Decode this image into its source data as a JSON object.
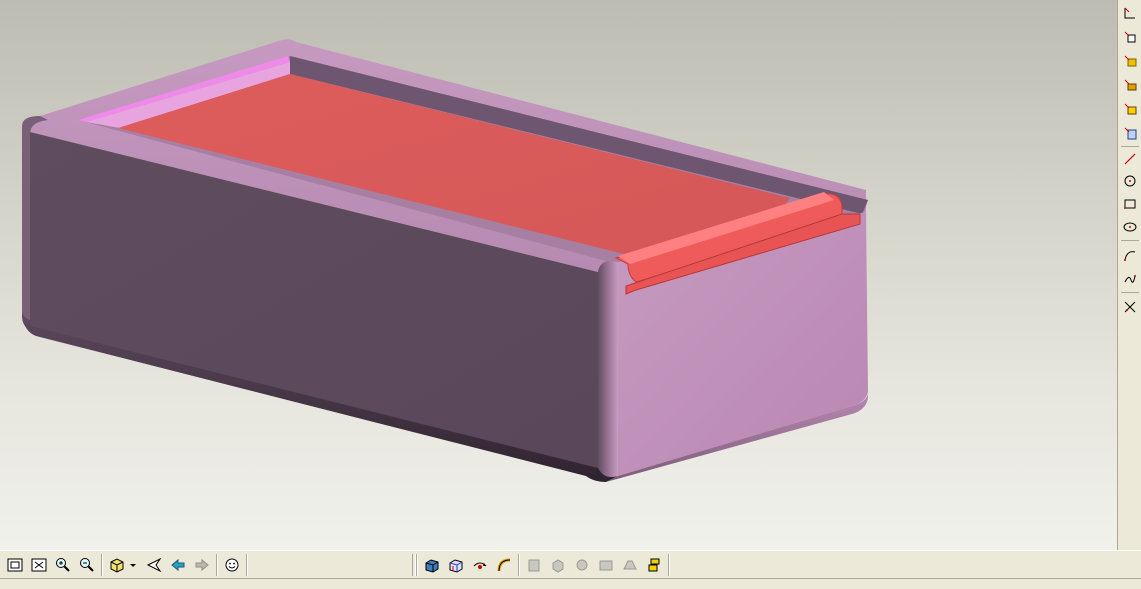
{
  "app": {
    "window_title": ""
  },
  "viewport": {
    "background_top": "#bcbcb2",
    "background_bottom": "#f1f1ec",
    "model": {
      "description_visible": false,
      "body_color_dark": "#5e4b5e",
      "body_color_light": "#bf91b9",
      "inner_floor_color": "#d95c5c",
      "highlight_color": "#f08aea"
    }
  },
  "right_toolbar": {
    "items": [
      {
        "name": "datum-plane-icon"
      },
      {
        "name": "datum-axis-icon"
      },
      {
        "name": "extrude-icon"
      },
      {
        "name": "revolve-icon"
      },
      {
        "name": "sweep-icon"
      },
      {
        "name": "blend-icon"
      },
      {
        "name": "sketch-line-icon"
      },
      {
        "name": "sketch-circle-icon"
      },
      {
        "name": "sketch-rectangle-icon"
      },
      {
        "name": "sketch-ellipse-icon"
      },
      {
        "name": "sketch-arc-icon"
      },
      {
        "name": "sketch-spline-icon"
      },
      {
        "name": "trim-icon"
      }
    ]
  },
  "bottom_toolbar": {
    "items": [
      {
        "name": "zoom-fit-icon"
      },
      {
        "name": "zoom-window-icon"
      },
      {
        "name": "zoom-in-icon"
      },
      {
        "name": "zoom-out-icon"
      },
      {
        "name": "view-orientation-icon"
      },
      {
        "name": "view-dropdown-icon"
      },
      {
        "name": "previous-view-icon"
      },
      {
        "name": "back-arrow-icon"
      },
      {
        "name": "forward-arrow-icon"
      },
      {
        "name": "smiley-icon"
      },
      {
        "name": "shaded-view-icon"
      },
      {
        "name": "hidden-line-icon"
      },
      {
        "name": "spin-center-icon"
      },
      {
        "name": "datum-display-icon"
      },
      {
        "name": "disabled-tool-1-icon"
      },
      {
        "name": "disabled-tool-2-icon"
      },
      {
        "name": "disabled-tool-3-icon"
      },
      {
        "name": "disabled-tool-4-icon"
      },
      {
        "name": "disabled-tool-5-icon"
      },
      {
        "name": "layer-icon"
      }
    ]
  }
}
